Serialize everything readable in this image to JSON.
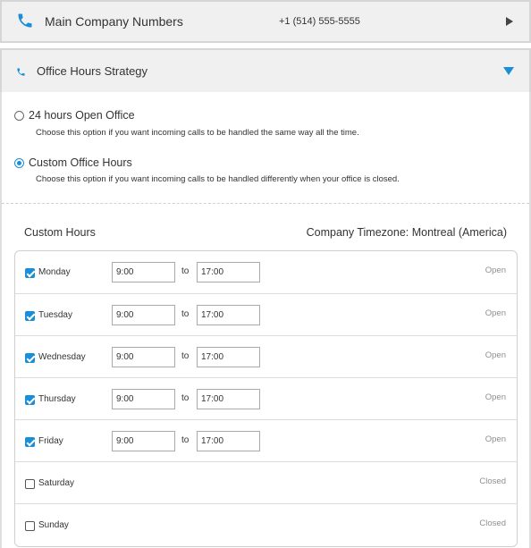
{
  "main_numbers": {
    "title": "Main Company Numbers",
    "number": "+1 (514) 555-5555",
    "icon": "phone-icon",
    "toggle_icon": "arrow-right-icon"
  },
  "office_hours": {
    "title": "Office Hours Strategy",
    "icon": "phone-icon",
    "toggle_icon": "arrow-down-icon",
    "accent_color": "#1a8ed6",
    "options": [
      {
        "label": "24 hours Open Office",
        "description": "Choose this option if you want incoming calls to be handled the same way all the time.",
        "selected": false
      },
      {
        "label": "Custom Office Hours",
        "description": "Choose this option if you want incoming calls to be handled differently when your office is closed.",
        "selected": true
      }
    ]
  },
  "custom_hours": {
    "title": "Custom Hours",
    "timezone": "Company Timezone: Montreal (America)",
    "to_label": "to",
    "days": [
      {
        "name": "Monday",
        "checked": true,
        "from": "9:00",
        "to": "17:00",
        "status": "Open"
      },
      {
        "name": "Tuesday",
        "checked": true,
        "from": "9:00",
        "to": "17:00",
        "status": "Open"
      },
      {
        "name": "Wednesday",
        "checked": true,
        "from": "9:00",
        "to": "17:00",
        "status": "Open"
      },
      {
        "name": "Thursday",
        "checked": true,
        "from": "9:00",
        "to": "17:00",
        "status": "Open"
      },
      {
        "name": "Friday",
        "checked": true,
        "from": "9:00",
        "to": "17:00",
        "status": "Open"
      },
      {
        "name": "Saturday",
        "checked": false,
        "status": "Closed"
      },
      {
        "name": "Sunday",
        "checked": false,
        "status": "Closed"
      }
    ]
  }
}
